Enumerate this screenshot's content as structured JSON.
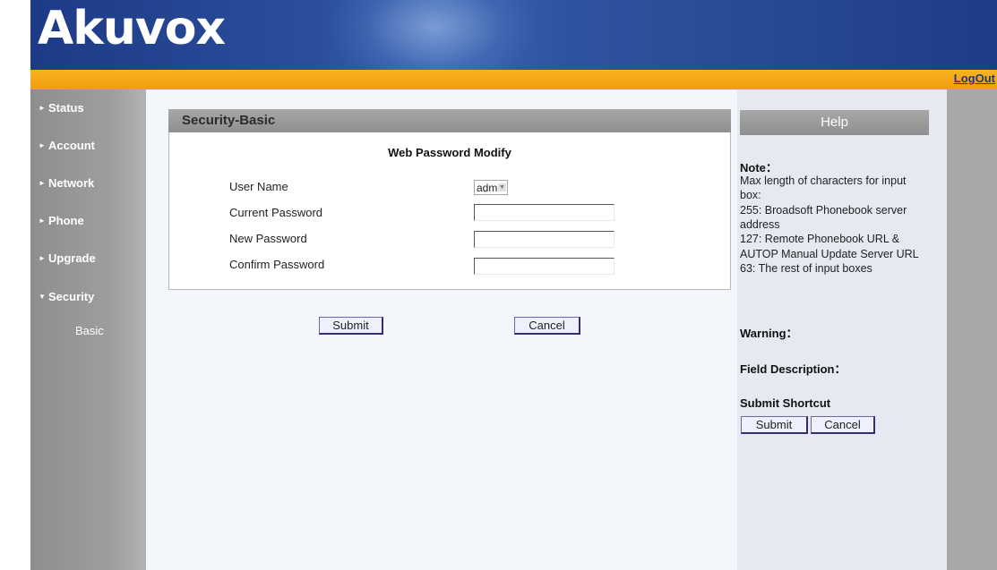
{
  "header": {
    "logo": "Akuvox",
    "logout": "LogOut"
  },
  "sidebar": {
    "items": [
      {
        "label": "Status",
        "arrow": "►"
      },
      {
        "label": "Account",
        "arrow": "►"
      },
      {
        "label": "Network",
        "arrow": "►"
      },
      {
        "label": "Phone",
        "arrow": "►"
      },
      {
        "label": "Upgrade",
        "arrow": "►"
      },
      {
        "label": "Security",
        "arrow": "▼"
      }
    ],
    "sub_items": [
      {
        "label": "Basic"
      }
    ]
  },
  "main": {
    "panel_title": "Security-Basic",
    "section_heading": "Web Password Modify",
    "fields": {
      "user_name": {
        "label": "User Name",
        "value": "admin"
      },
      "current_password": {
        "label": "Current Password",
        "value": ""
      },
      "new_password": {
        "label": "New Password",
        "value": ""
      },
      "confirm_password": {
        "label": "Confirm Password",
        "value": ""
      }
    },
    "submit_label": "Submit",
    "cancel_label": "Cancel"
  },
  "help": {
    "title": "Help",
    "note_heading": "Note：",
    "note_lines": [
      "Max length of characters for input",
      "box:",
      "255: Broadsoft Phonebook server",
      "address",
      "127: Remote Phonebook URL &",
      "AUTOP Manual Update Server URL",
      "63: The rest of input boxes"
    ],
    "warning_heading": "Warning：",
    "field_description_heading": "Field Description：",
    "submit_shortcut_heading": "Submit Shortcut",
    "submit_label": "Submit",
    "cancel_label": "Cancel"
  },
  "colors": {
    "header_blue": "#1d3a86",
    "accent_orange": "#f5a81a",
    "sidebar_gray": "#9e9e9e"
  }
}
